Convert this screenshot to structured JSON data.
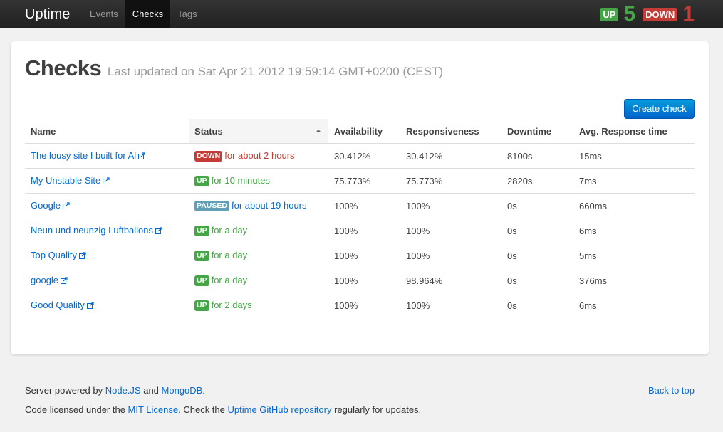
{
  "brand": "Uptime",
  "nav": [
    {
      "label": "Events",
      "active": false
    },
    {
      "label": "Checks",
      "active": true
    },
    {
      "label": "Tags",
      "active": false
    }
  ],
  "counters": {
    "up_label": "UP",
    "up_count": "5",
    "down_label": "DOWN",
    "down_count": "1"
  },
  "header": {
    "title": "Checks",
    "subtitle": "Last updated on Sat Apr 21 2012 19:59:14 GMT+0200 (CEST)"
  },
  "create_button": "Create check",
  "table": {
    "columns": [
      "Name",
      "Status",
      "Availability",
      "Responsiveness",
      "Downtime",
      "Avg. Response time"
    ],
    "sorted_column": "Status",
    "rows": [
      {
        "name": "The lousy site I built for Al",
        "status": "down",
        "status_label": "DOWN",
        "status_text": "for about 2 hours",
        "availability": "30.412%",
        "responsiveness": "30.412%",
        "downtime": "8100s",
        "avg_response": "15ms"
      },
      {
        "name": "My Unstable Site",
        "status": "up",
        "status_label": "UP",
        "status_text": "for 10 minutes",
        "availability": "75.773%",
        "responsiveness": "75.773%",
        "downtime": "2820s",
        "avg_response": "7ms"
      },
      {
        "name": "Google",
        "status": "paused",
        "status_label": "PAUSED",
        "status_text": "for about 19 hours",
        "availability": "100%",
        "responsiveness": "100%",
        "downtime": "0s",
        "avg_response": "660ms"
      },
      {
        "name": "Neun und neunzig Luftballons",
        "status": "up",
        "status_label": "UP",
        "status_text": "for a day",
        "availability": "100%",
        "responsiveness": "100%",
        "downtime": "0s",
        "avg_response": "6ms"
      },
      {
        "name": "Top Quality",
        "status": "up",
        "status_label": "UP",
        "status_text": "for a day",
        "availability": "100%",
        "responsiveness": "100%",
        "downtime": "0s",
        "avg_response": "5ms"
      },
      {
        "name": "google",
        "status": "up",
        "status_label": "UP",
        "status_text": "for a day",
        "availability": "100%",
        "responsiveness": "98.964%",
        "downtime": "0s",
        "avg_response": "376ms"
      },
      {
        "name": "Good Quality",
        "status": "up",
        "status_label": "UP",
        "status_text": "for 2 days",
        "availability": "100%",
        "responsiveness": "100%",
        "downtime": "0s",
        "avg_response": "6ms"
      }
    ]
  },
  "footer": {
    "line1_prefix": "Server powered by ",
    "nodejs_link": "Node.JS",
    "line1_and": " and ",
    "mongodb_link": "MongoDB",
    "line1_suffix": ".",
    "line2_prefix": "Code licensed under the ",
    "mit_link": "MIT License",
    "line2_mid": ". Check the ",
    "github_link": "Uptime GitHub repository",
    "line2_suffix": " regularly for updates.",
    "back_to_top": "Back to top"
  },
  "icons": {
    "external_link": "external-link-icon",
    "sort": "sort-ascending-icon"
  },
  "colors": {
    "up": "#46a546",
    "down": "#c43c35",
    "paused": "#62a0b8",
    "link": "#0069d6",
    "primary_button": "#0064cd"
  }
}
